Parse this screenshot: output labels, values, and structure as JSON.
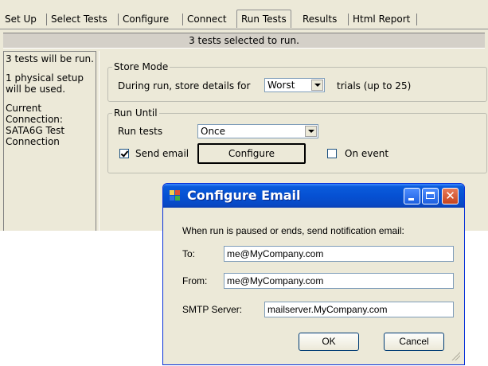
{
  "tabs": [
    "Set Up",
    "Select Tests",
    "Configure",
    "Connect",
    "Run Tests",
    "Results",
    "Html Report"
  ],
  "active_tab": "Run Tests",
  "header_status": "3 tests selected to run.",
  "sidebar": {
    "tests_info": "3 tests will be run.",
    "setup_info": "1 physical setup will be used.",
    "connection_info": "Current Connection: SATA6G Test Connection"
  },
  "store_mode": {
    "group_label": "Store Mode",
    "prefix": "During run, store details for",
    "selected": "Worst",
    "suffix": "trials (up to 25)"
  },
  "run_until": {
    "group_label": "Run Until",
    "run_tests_label": "Run tests",
    "run_tests_selected": "Once",
    "send_email_label": "Send email",
    "send_email_checked": true,
    "configure_button": "Configure",
    "on_event_label": "On event",
    "on_event_checked": false
  },
  "dialog": {
    "title": "Configure Email",
    "instruction": "When run is paused or ends, send notification email:",
    "to_label": "To:",
    "to_value": "me@MyCompany.com",
    "from_label": "From:",
    "from_value": "me@MyCompany.com",
    "smtp_label": "SMTP Server:",
    "smtp_value": "mailserver.MyCompany.com",
    "ok_button": "OK",
    "cancel_button": "Cancel"
  },
  "colors": {
    "panel_bg": "#ece9d8",
    "titlebar_blue": "#0651d3",
    "close_red": "#c6441e"
  }
}
